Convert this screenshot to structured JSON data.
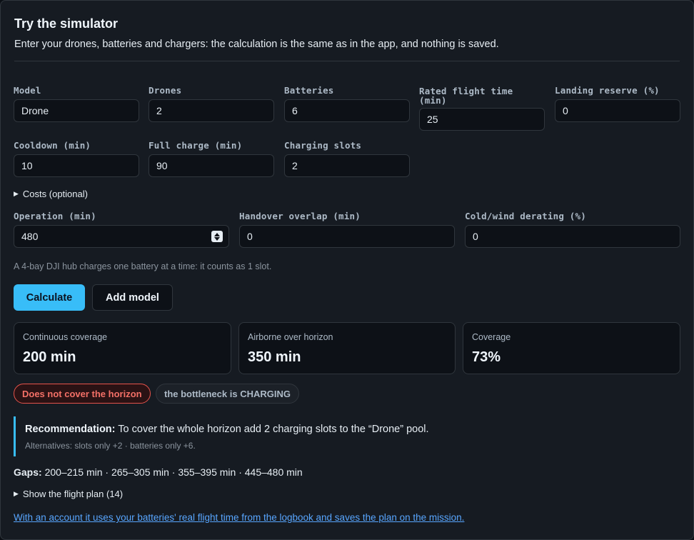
{
  "header": {
    "title": "Try the simulator",
    "intro": "Enter your drones, batteries and chargers: the calculation is the same as in the app, and nothing is saved."
  },
  "fields_row1": [
    {
      "label": "Model",
      "value": "Drone"
    },
    {
      "label": "Drones",
      "value": "2"
    },
    {
      "label": "Batteries",
      "value": "6"
    },
    {
      "label": "Rated flight time (min)",
      "value": "25"
    },
    {
      "label": "Landing reserve (%)",
      "value": "0"
    }
  ],
  "fields_row2": [
    {
      "label": "Cooldown (min)",
      "value": "10"
    },
    {
      "label": "Full charge (min)",
      "value": "90"
    },
    {
      "label": "Charging slots",
      "value": "2"
    }
  ],
  "costs_toggle": "Costs (optional)",
  "fields_row3": [
    {
      "label": "Operation (min)",
      "value": "480"
    },
    {
      "label": "Handover overlap (min)",
      "value": "0"
    },
    {
      "label": "Cold/wind derating (%)",
      "value": "0"
    }
  ],
  "hint": "A 4-bay DJI hub charges one battery at a time: it counts as 1 slot.",
  "buttons": {
    "calculate": "Calculate",
    "add_model": "Add model"
  },
  "stats": [
    {
      "label": "Continuous coverage",
      "value": "200 min"
    },
    {
      "label": "Airborne over horizon",
      "value": "350 min"
    },
    {
      "label": "Coverage",
      "value": "73%"
    }
  ],
  "badges": {
    "status": "Does not cover the horizon",
    "bottleneck": "the bottleneck is CHARGING"
  },
  "recommendation": {
    "label": "Recommendation:",
    "text": "To cover the whole horizon add 2 charging slots to the “Drone” pool.",
    "alternatives": "Alternatives: slots only +2 · batteries only +6."
  },
  "gaps": {
    "label": "Gaps:",
    "value": "200–215 min · 265–305 min · 355–395 min · 445–480 min"
  },
  "flight_plan_toggle": "Show the flight plan (14)",
  "footer_link": "With an account it uses your batteries' real flight time from the logbook and saves the plan on the mission.",
  "colors": {
    "accent": "#38bdf8",
    "danger": "#f47067",
    "link": "#58a6ff"
  }
}
